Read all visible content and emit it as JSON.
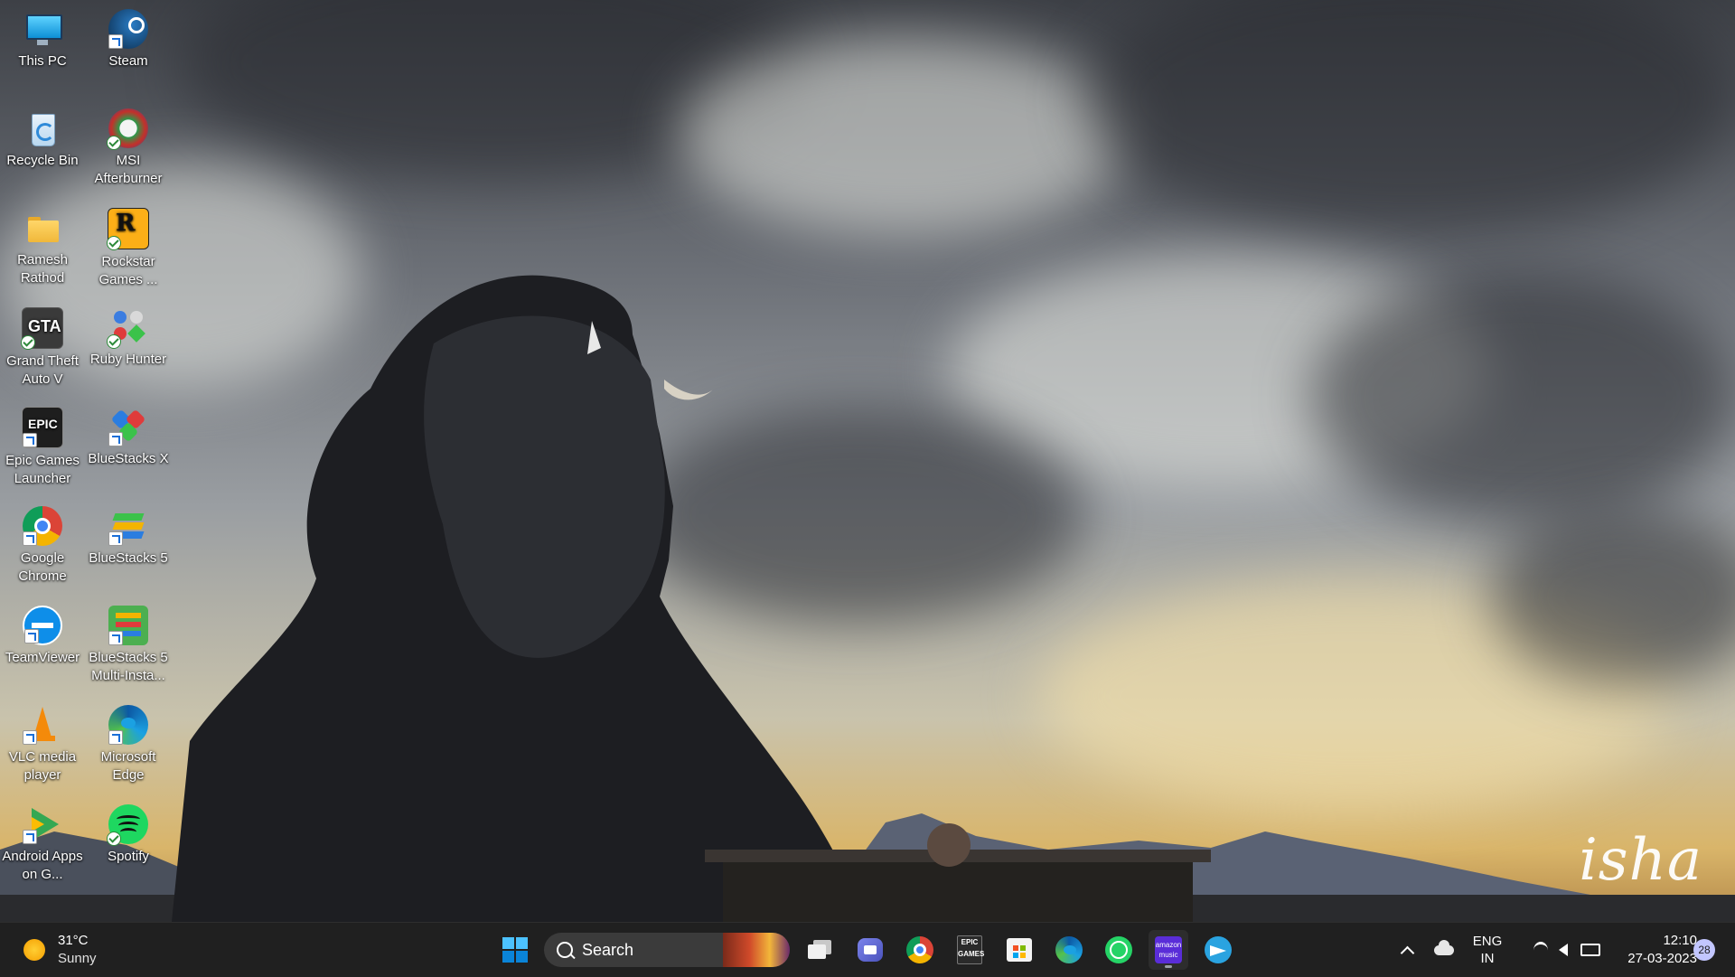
{
  "desktop": {
    "wallpaper_logo": "isha",
    "icons": [
      {
        "label": "This PC",
        "icon": "monitor-icon"
      },
      {
        "label": "Steam",
        "icon": "steam-icon"
      },
      {
        "label": "Recycle Bin",
        "icon": "recycle-bin-icon"
      },
      {
        "label": "MSI Afterburner",
        "icon": "msi-afterburner-icon"
      },
      {
        "label": "Ramesh Rathod",
        "icon": "folder-icon"
      },
      {
        "label": "Rockstar Games ...",
        "icon": "rockstar-icon"
      },
      {
        "label": "Grand Theft Auto V",
        "icon": "gta-icon"
      },
      {
        "label": "Ruby Hunter",
        "icon": "ruby-hunter-icon"
      },
      {
        "label": "Epic Games Launcher",
        "icon": "epic-games-icon"
      },
      {
        "label": "BlueStacks X",
        "icon": "bluestacks-x-icon"
      },
      {
        "label": "Google Chrome",
        "icon": "chrome-icon"
      },
      {
        "label": "BlueStacks 5",
        "icon": "bluestacks-5-icon"
      },
      {
        "label": "TeamViewer",
        "icon": "teamviewer-icon"
      },
      {
        "label": "BlueStacks 5 Multi-Insta...",
        "icon": "bluestacks-multi-icon"
      },
      {
        "label": "VLC media player",
        "icon": "vlc-icon"
      },
      {
        "label": "Microsoft Edge",
        "icon": "edge-icon"
      },
      {
        "label": "Android Apps on G...",
        "icon": "google-play-icon"
      },
      {
        "label": "Spotify",
        "icon": "spotify-icon"
      }
    ]
  },
  "taskbar": {
    "weather": {
      "temp": "31°C",
      "condition": "Sunny",
      "icon": "sun-icon"
    },
    "search": {
      "label": "Search"
    },
    "pinned": [
      {
        "name": "start-button",
        "icon": "windows-icon"
      },
      {
        "name": "task-view",
        "icon": "task-view-icon"
      },
      {
        "name": "teams-chat",
        "icon": "teams-icon"
      },
      {
        "name": "chrome",
        "icon": "chrome-icon"
      },
      {
        "name": "epic-games",
        "icon": "epic-games-icon"
      },
      {
        "name": "microsoft-store",
        "icon": "store-icon"
      },
      {
        "name": "edge",
        "icon": "edge-icon"
      },
      {
        "name": "whatsapp",
        "icon": "whatsapp-icon"
      },
      {
        "name": "amazon-music",
        "icon": "amazon-music-icon",
        "text": "amazon music"
      },
      {
        "name": "telegram",
        "icon": "telegram-icon"
      }
    ],
    "epic_text": "EPIC GAMES",
    "language": {
      "line1": "ENG",
      "line2": "IN"
    },
    "clock": {
      "time": "12:10",
      "date": "27-03-2023"
    },
    "notification_count": "28",
    "colors": {
      "background": "#202020",
      "accent": "#0078d4"
    }
  }
}
